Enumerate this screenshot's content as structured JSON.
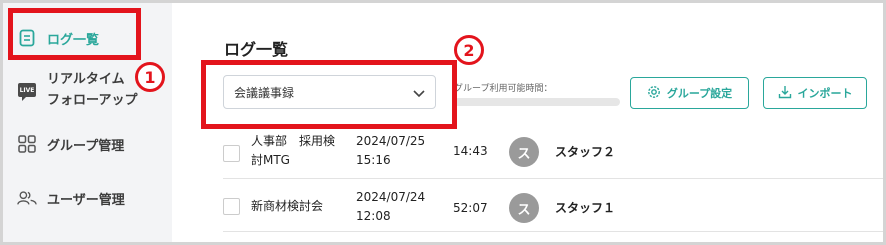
{
  "sidebar": {
    "items": [
      {
        "label": "ログ一覧",
        "icon": "document-icon",
        "active": true
      },
      {
        "label": "リアルタイム\nフォローアップ",
        "icon": "live-icon",
        "icon_text": "LIVE",
        "active": false
      },
      {
        "label": "グループ管理",
        "icon": "grid-icon",
        "active": false
      },
      {
        "label": "ユーザー管理",
        "icon": "users-icon",
        "active": false
      }
    ]
  },
  "main": {
    "title": "ログ一覧",
    "group_select": {
      "value": "会議議事録",
      "icon": "chevron-down-icon"
    },
    "usage": {
      "label": "グループ利用可能時間：",
      "fraction": 0.0
    },
    "buttons": {
      "group_settings": "グループ設定",
      "import": "インポート"
    },
    "rows": [
      {
        "name": "人事部　採用検討MTG",
        "date": "2024/07/25",
        "time": "15:16",
        "duration": "14:43",
        "avatar": "ス",
        "staff": "スタッフ２"
      },
      {
        "name": "新商材検討会",
        "date": "2024/07/24",
        "time": "12:08",
        "duration": "52:07",
        "avatar": "ス",
        "staff": "スタッフ１"
      }
    ]
  },
  "annotations": {
    "badge_1": "1",
    "badge_2": "2"
  },
  "colors": {
    "accent": "#2aa79b",
    "annotation_red": "#e3141c",
    "sidebar_bg": "#f3f4f6",
    "avatar_bg": "#9a9a9a"
  }
}
